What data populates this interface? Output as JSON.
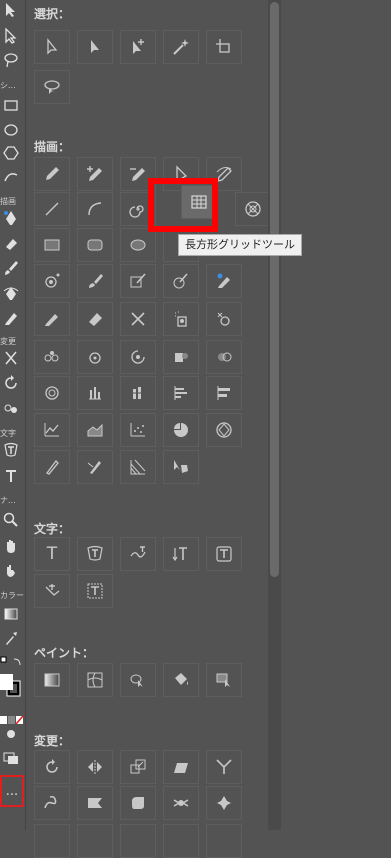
{
  "toolbar": {
    "labels": {
      "select": "選択",
      "shape": "シ...",
      "draw": "描画",
      "modify": "変更",
      "text": "文字",
      "nav": "ナ...",
      "color": "カラー"
    },
    "more_label": "..."
  },
  "panel": {
    "sections": {
      "select": "選択：",
      "draw": "描画：",
      "text": "文字：",
      "paint": "ペイント：",
      "modify": "変更："
    },
    "text_icons": {
      "type": "T"
    }
  },
  "tooltip": {
    "text": "長方形グリッドツール"
  },
  "colors": {
    "highlight": "#ff0000",
    "panel_bg": "#535353",
    "icon": "#c8c8c8"
  }
}
